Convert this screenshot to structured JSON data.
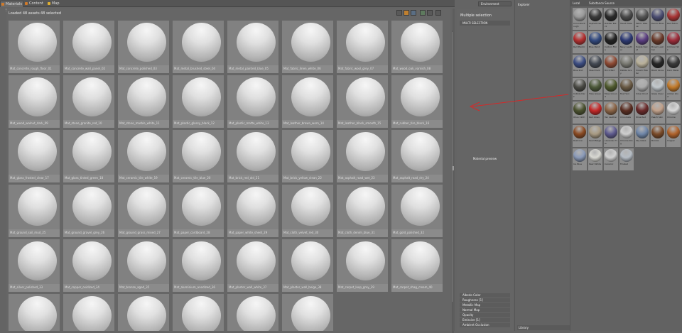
{
  "tabs": [
    {
      "label": "Materials Scene",
      "color": "#d07a2a"
    },
    {
      "label": "Content",
      "color": "#d07a2a"
    },
    {
      "label": "Map",
      "color": "#e0b030"
    }
  ],
  "toolbar": {
    "left_text": "Loaded 48 assets",
    "selected_text": "48 selected",
    "icons": [
      "sort-icon",
      "folder-icon",
      "view-icon",
      "grid-icon",
      "list-icon",
      "settings-icon"
    ]
  },
  "assets": [
    {
      "caption": "Mat_concrete_rough_floor_01"
    },
    {
      "caption": "Mat_concrete_wall_panel_02"
    },
    {
      "caption": "Mat_concrete_polished_03"
    },
    {
      "caption": "Mat_metal_brushed_steel_04"
    },
    {
      "caption": "Mat_metal_painted_blue_05"
    },
    {
      "caption": "Mat_fabric_linen_white_06"
    },
    {
      "caption": "Mat_fabric_wool_grey_07"
    },
    {
      "caption": "Mat_wood_oak_varnish_08"
    },
    {
      "caption": "Mat_wood_walnut_dark_09"
    },
    {
      "caption": "Mat_stone_granite_red_10"
    },
    {
      "caption": "Mat_stone_marble_white_11"
    },
    {
      "caption": "Mat_plastic_glossy_black_12"
    },
    {
      "caption": "Mat_plastic_matte_white_13"
    },
    {
      "caption": "Mat_leather_brown_worn_14"
    },
    {
      "caption": "Mat_leather_black_smooth_15"
    },
    {
      "caption": "Mat_rubber_tire_black_16"
    },
    {
      "caption": "Mat_glass_frosted_clear_17"
    },
    {
      "caption": "Mat_glass_tinted_green_18"
    },
    {
      "caption": "Mat_ceramic_tile_white_19"
    },
    {
      "caption": "Mat_ceramic_tile_blue_20"
    },
    {
      "caption": "Mat_brick_red_old_21"
    },
    {
      "caption": "Mat_brick_yellow_clean_22"
    },
    {
      "caption": "Mat_asphalt_road_wet_23"
    },
    {
      "caption": "Mat_asphalt_road_dry_24"
    },
    {
      "caption": "Mat_ground_soil_mud_25"
    },
    {
      "caption": "Mat_ground_gravel_grey_26"
    },
    {
      "caption": "Mat_ground_grass_mixed_27"
    },
    {
      "caption": "Mat_paper_cardboard_28"
    },
    {
      "caption": "Mat_paper_white_sheet_29"
    },
    {
      "caption": "Mat_cloth_velvet_red_30"
    },
    {
      "caption": "Mat_cloth_denim_blue_31"
    },
    {
      "caption": "Mat_gold_polished_32"
    },
    {
      "caption": "Mat_silver_polished_33"
    },
    {
      "caption": "Mat_copper_oxidized_34"
    },
    {
      "caption": "Mat_bronze_aged_35"
    },
    {
      "caption": "Mat_aluminium_anodized_36"
    },
    {
      "caption": "Mat_plaster_wall_white_37"
    },
    {
      "caption": "Mat_plaster_wall_beige_38"
    },
    {
      "caption": "Mat_carpet_loop_grey_39"
    },
    {
      "caption": "Mat_carpet_shag_cream_40"
    },
    {
      "caption": "Mat_terrazzo_speckle_41"
    },
    {
      "caption": "Mat_cork_natural_42"
    },
    {
      "caption": "Mat_slate_dark_tile_43"
    },
    {
      "caption": "Mat_sandstone_warm_44"
    },
    {
      "caption": "Mat_basalt_black_45"
    },
    {
      "caption": "Mat_limestone_pale_46"
    }
  ],
  "side": {
    "title": "Multiple selection",
    "header": "MULTI SELECTION",
    "center_text": "Material preview",
    "items": [
      "Albedo Color",
      "Roughness [1]",
      "Metallic Map",
      "Normal Map",
      "Opacity",
      "Emissive [1]",
      "Ambient Occlusion"
    ]
  },
  "topright_box": "Environment",
  "explorer": {
    "header": "Explorer",
    "footer": "Library"
  },
  "library": {
    "tab1": "Local",
    "tab2": "Substance Source",
    "swatches": [
      {
        "name": "Concrete Rough",
        "color": "#9a9a9a"
      },
      {
        "name": "Asphalt Dark",
        "color": "#3a3a3a"
      },
      {
        "name": "Rubber Black",
        "color": "#2a2a2a"
      },
      {
        "name": "Tread Plate",
        "color": "#4a4a4a"
      },
      {
        "name": "Fabric Weave",
        "color": "#555"
      },
      {
        "name": "Denim Blue",
        "color": "#4c4e72"
      },
      {
        "name": "Red Fabric",
        "color": "#a83535"
      },
      {
        "name": "Red Plastic",
        "color": "#b33030"
      },
      {
        "name": "Blue Paint",
        "color": "#324a80"
      },
      {
        "name": "Carbon Fibre",
        "color": "#222"
      },
      {
        "name": "Navy Leather",
        "color": "#2d3a74"
      },
      {
        "name": "Purple Velvet",
        "color": "#5a3d80"
      },
      {
        "name": "Brown Leather",
        "color": "#6a3a2a"
      },
      {
        "name": "Crimson Silk",
        "color": "#9e2c3a"
      },
      {
        "name": "Blue Knit",
        "color": "#3c4d82"
      },
      {
        "name": "Steel Dark",
        "color": "#444a54"
      },
      {
        "name": "Brick Red",
        "color": "#8e4a34"
      },
      {
        "name": "Pebble Grey",
        "color": "#7a7a72"
      },
      {
        "name": "Cream Plaster",
        "color": "#b9b19a"
      },
      {
        "name": "Black Gloss",
        "color": "#262626"
      },
      {
        "name": "Dark Metal",
        "color": "#3a3a3a"
      },
      {
        "name": "Cobble Dark",
        "color": "#4a4a44"
      },
      {
        "name": "Tiles Green",
        "color": "#4d5a3a"
      },
      {
        "name": "Moss Ground",
        "color": "#4f5a2e"
      },
      {
        "name": "Mud Soil",
        "color": "#6a5a44"
      },
      {
        "name": "Silver Knurl",
        "color": "#aaaaaa"
      },
      {
        "name": "Glass Clear",
        "color": "#c2c8cc"
      },
      {
        "name": "Amber Glow",
        "color": "#c27a2a"
      },
      {
        "name": "Olive Cloth",
        "color": "#4b5230"
      },
      {
        "name": "Red Gloss",
        "color": "#c52828"
      },
      {
        "name": "Tan Leather",
        "color": "#8a6446"
      },
      {
        "name": "Chocolate",
        "color": "#5a2e22"
      },
      {
        "name": "Wine Red",
        "color": "#6a2a2a"
      },
      {
        "name": "Peach Skin",
        "color": "#c0a08a"
      },
      {
        "name": "Chrome",
        "color": "#d8d8d8"
      },
      {
        "name": "Rust Iron",
        "color": "#8a4a22"
      },
      {
        "name": "Sand Beige",
        "color": "#a89a82"
      },
      {
        "name": "Lavender Tile",
        "color": "#5e5a8e"
      },
      {
        "name": "Chrome Ring",
        "color": "#cfcfcf"
      },
      {
        "name": "Sky Glass",
        "color": "#6f86a8"
      },
      {
        "name": "Bronze",
        "color": "#7a4a28"
      },
      {
        "name": "Copper",
        "color": "#b0622a"
      },
      {
        "name": "Ice Blue",
        "color": "#8a9ab8"
      },
      {
        "name": "Pearl White",
        "color": "#d8d8d2"
      },
      {
        "name": "Ceramic",
        "color": "#cfcfcf"
      },
      {
        "name": "Frosted",
        "color": "#b5bcc4"
      }
    ]
  }
}
